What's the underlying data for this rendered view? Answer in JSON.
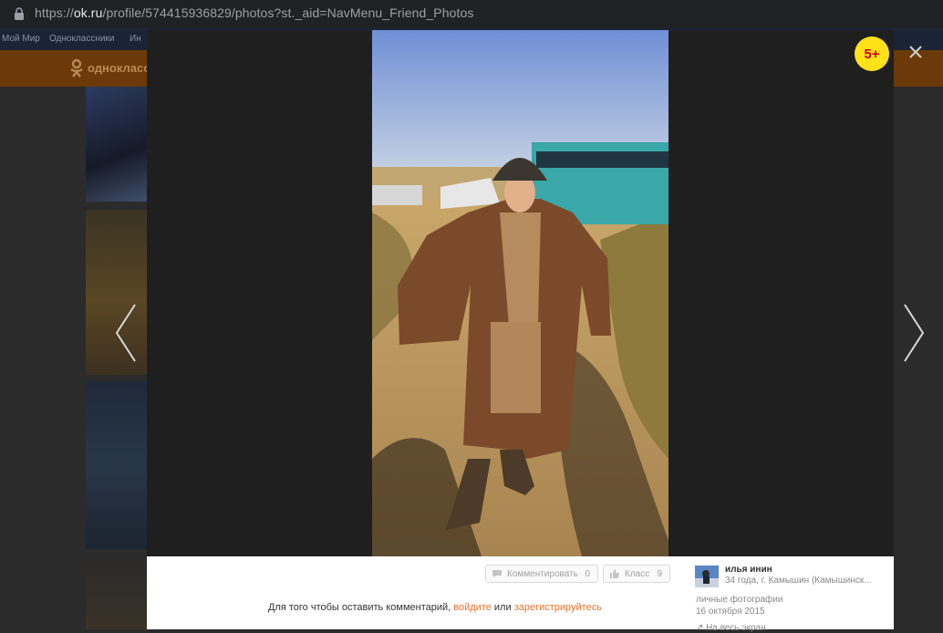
{
  "browser": {
    "url_scheme": "https://",
    "url_host": "ok.ru",
    "url_path": "/profile/574415936829/photos?st._aid=NavMenu_Friend_Photos"
  },
  "background_page": {
    "bookmarks": [
      "Мой Мир",
      "Одноклассники",
      "Ин"
    ],
    "logo_text": "одноклассн"
  },
  "viewer": {
    "age_rating": "5+",
    "actions": {
      "comment_label": "Комментировать",
      "comment_count": "0",
      "like_label": "Класс",
      "like_count": "9"
    },
    "comment_prompt": {
      "text_before": "Для того чтобы оставить комментарий, ",
      "login_link": "войдите",
      "text_middle": " или ",
      "register_link": "зарегистрируйтесь"
    },
    "author": {
      "name": "илья инин",
      "meta": "34 года, г. Камышин (Камышинск..."
    },
    "album": "личные фотографии",
    "date": "16 октября 2015",
    "share_label": "На весь экран"
  },
  "colors": {
    "accent": "#eb722e",
    "badge": "#ffe11a",
    "badge_text": "#d10000",
    "header": "#ee8208"
  }
}
